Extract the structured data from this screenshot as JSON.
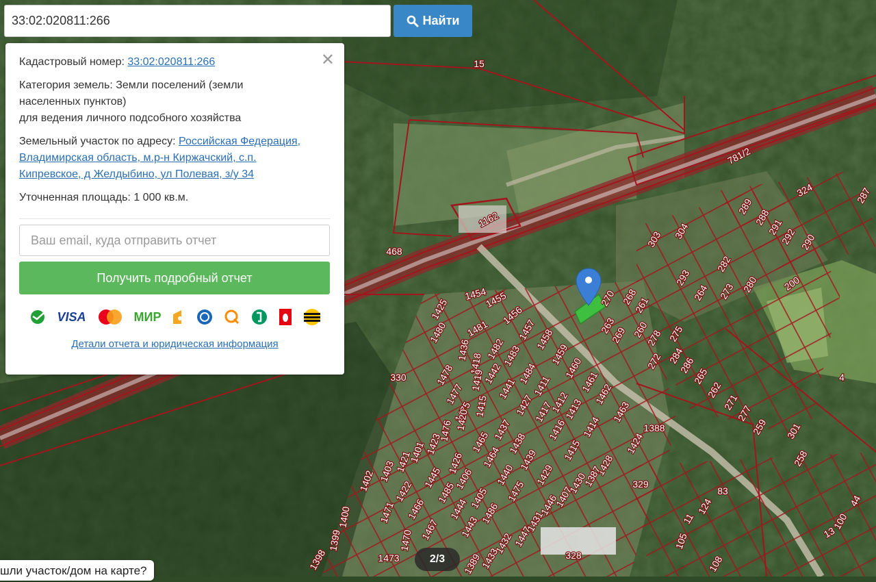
{
  "search": {
    "value": "33:02:020811:266",
    "button_label": "Найти",
    "icon": "search-icon"
  },
  "panel": {
    "close_icon": "close-icon",
    "cadastral_label": "Кадастровый номер:",
    "cadastral_value": "33:02:020811:266",
    "category_label": "Категория земель:",
    "category_value": "Земли поселений (земли населенных пунктов)",
    "usage": "для ведения личного подсобного хозяйства",
    "address_label": "Земельный участок по адресу:",
    "address_value": "Российская Федерация, Владимирская область, м.р-н Киржачский, с.п. Кипревское, д Желдыбино, ул Полевая, з/у 34",
    "area_label": "Уточненная площадь:",
    "area_value": "1 000 кв.м.",
    "email_placeholder": "Ваш email, куда отправить отчет",
    "report_button": "Получить подробный отчет",
    "payments": [
      "sberbank-icon",
      "VISA",
      "mastercard-icon",
      "МИР",
      "yandex-money-icon",
      "webmoney-icon",
      "qiwi-icon",
      "megafon-icon",
      "mts-icon",
      "beeline-icon"
    ],
    "details_link": "Детали отчета и юридическая информация"
  },
  "map": {
    "colors": {
      "boundary": "#b0121b",
      "selected": "#3fbf3f",
      "marker": "#3a7fd5"
    },
    "labels": [
      "15",
      "781/2",
      "324",
      "287",
      "1162",
      "468",
      "303",
      "304",
      "289",
      "288",
      "291",
      "292",
      "290",
      "330",
      "200",
      "282",
      "293",
      "264",
      "273",
      "280",
      "270",
      "268",
      "261",
      "263",
      "269",
      "260",
      "278",
      "275",
      "272",
      "284",
      "286",
      "265",
      "262",
      "271",
      "277",
      "259",
      "301",
      "258",
      "4",
      "1454",
      "1455",
      "1456",
      "1425",
      "1480",
      "1481",
      "1457",
      "1458",
      "1436",
      "1418",
      "1482",
      "1483",
      "1459",
      "1460",
      "1478",
      "1419",
      "1442",
      "1484",
      "1461",
      "1477",
      "1441",
      "1411",
      "1462",
      "1475",
      "1420",
      "1415",
      "1427",
      "1417",
      "1412",
      "1413",
      "1416",
      "1463",
      "1414",
      "1388",
      "1437",
      "1465",
      "1438",
      "1423",
      "1401",
      "1426",
      "1476",
      "1464",
      "1439",
      "1415",
      "1428",
      "1424",
      "1402",
      "1403",
      "1421",
      "1406",
      "1440",
      "1429",
      "1430",
      "1387",
      "1422",
      "1445",
      "1485",
      "1405",
      "1475",
      "1407",
      "1471",
      "1466",
      "1444",
      "1486",
      "1431",
      "1446",
      "1400",
      "1399",
      "1470",
      "1467",
      "1443",
      "1432",
      "1447",
      "1398",
      "1473",
      "1389",
      "1433",
      "328",
      "329",
      "124",
      "11",
      "105",
      "108",
      "100",
      "13",
      "44",
      "83"
    ],
    "pager": "2/3",
    "tip": "шли участок/дом на карте?"
  }
}
